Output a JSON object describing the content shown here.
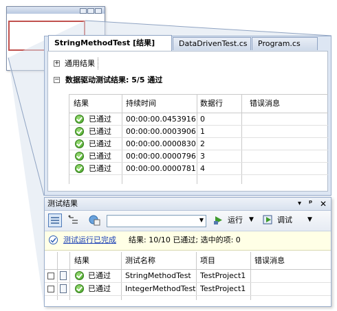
{
  "colors": {
    "accent": "#1a3fb5",
    "pass": "#3e9b1e",
    "thumb_red": "#c0504d"
  },
  "tabs": [
    {
      "label": "StringMethodTest [结果]",
      "active": true
    },
    {
      "label": "DataDrivenTest.cs",
      "active": false
    },
    {
      "label": "Program.cs",
      "active": false
    }
  ],
  "summary": {
    "general": "通用结果",
    "datadriven": "数据驱动测试结果: 5/5 通过"
  },
  "results_grid": {
    "headers": [
      "结果",
      "持续时间",
      "数据行",
      "错误消息"
    ],
    "rows": [
      {
        "status": "已通过",
        "duration": "00:00:00.0453916",
        "row": "0",
        "error": ""
      },
      {
        "status": "已通过",
        "duration": "00:00:00.0003906",
        "row": "1",
        "error": ""
      },
      {
        "status": "已通过",
        "duration": "00:00:00.0000830",
        "row": "2",
        "error": ""
      },
      {
        "status": "已通过",
        "duration": "00:00:00.0000796",
        "row": "3",
        "error": ""
      },
      {
        "status": "已通过",
        "duration": "00:00:00.0000781",
        "row": "4",
        "error": ""
      }
    ]
  },
  "test_results": {
    "title": "测试结果",
    "window_buttons": [
      "▾",
      "ᵖ",
      "✕"
    ],
    "toolbar": {
      "run": "运行",
      "debug": "调试",
      "run_icon": "run-icon",
      "debug_icon": "debug-icon"
    },
    "notice": {
      "link": "测试运行已完成",
      "text": "结果: 10/10 已通过; 选中的项: 0"
    },
    "headers": [
      "结果",
      "测试名称",
      "项目",
      "错误消息"
    ],
    "rows": [
      {
        "status": "已通过",
        "name": "StringMethodTest",
        "project": "TestProject1",
        "error": ""
      },
      {
        "status": "已通过",
        "name": "IntegerMethodTest",
        "project": "TestProject1",
        "error": ""
      }
    ]
  }
}
